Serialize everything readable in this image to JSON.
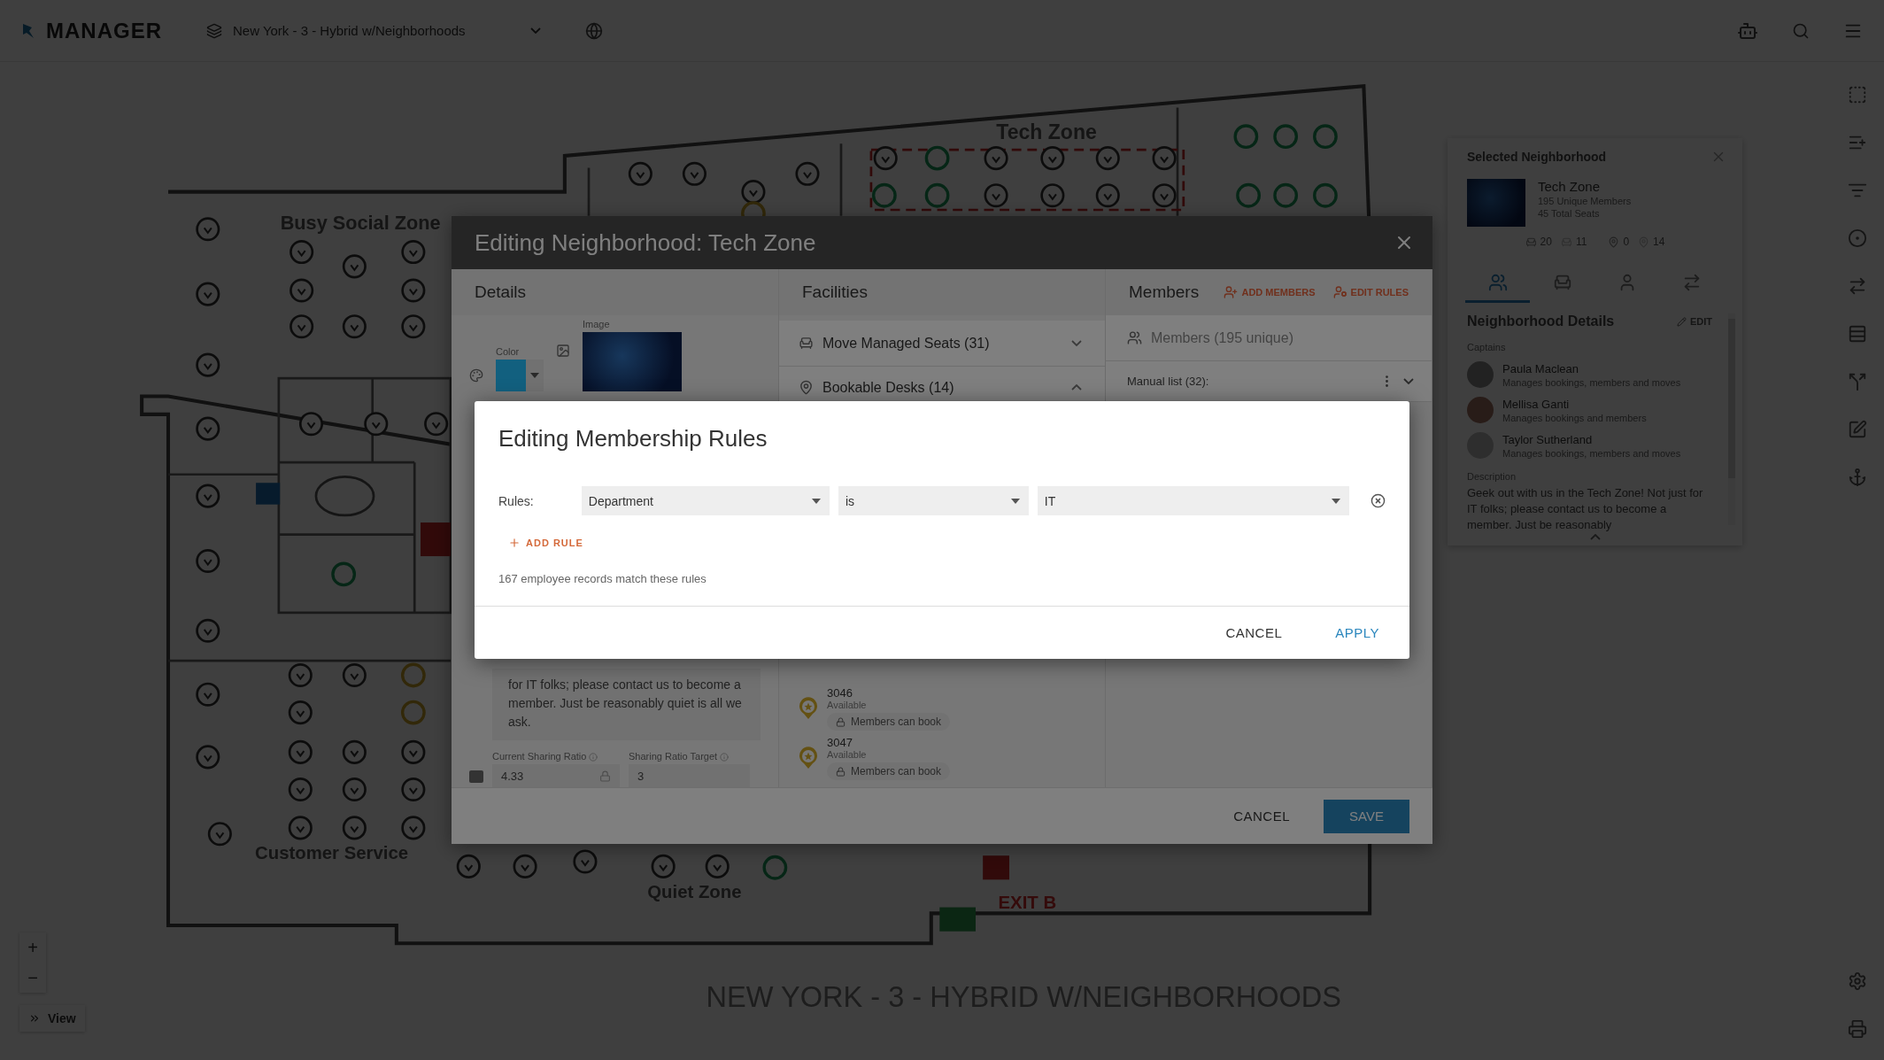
{
  "top_bar": {
    "app_name": "MANAGER",
    "floor_selector": "New York - 3 - Hybrid w/Neighborhoods"
  },
  "floor_map": {
    "zone_labels": [
      "Tech Zone",
      "Busy Social Zone",
      "Customer Service",
      "Quiet Zone"
    ],
    "exit_label": "EXIT B",
    "floor_title": "NEW YORK - 3 - HYBRID W/NEIGHBORHOODS"
  },
  "map_controls": {
    "zoom_in": "+",
    "zoom_out": "−",
    "view": "View"
  },
  "selected_neighborhood": {
    "title": "Selected Neighborhood",
    "name": "Tech Zone",
    "members": "195 Unique Members",
    "seats": "45 Total Seats",
    "stats": [
      {
        "kind": "seat",
        "value": "20"
      },
      {
        "kind": "seat-free",
        "value": "11"
      },
      {
        "kind": "pin",
        "value": "0"
      },
      {
        "kind": "pin-free",
        "value": "14"
      }
    ],
    "tabs": [
      {
        "kind": "members",
        "selected": true
      },
      {
        "kind": "seats",
        "selected": false
      },
      {
        "kind": "person",
        "selected": false
      },
      {
        "kind": "moves",
        "selected": false
      }
    ],
    "section_title": "Neighborhood Details",
    "edit": "EDIT",
    "captains_label": "Captains",
    "captains": [
      {
        "name": "Paula Maclean",
        "role": "Manages bookings, members and moves"
      },
      {
        "name": "Mellisa Ganti",
        "role": "Manages bookings and members"
      },
      {
        "name": "Taylor Sutherland",
        "role": "Manages bookings, members and moves"
      }
    ],
    "description_label": "Description",
    "description": "Geek out with us in the Tech Zone! Not just for IT folks; please contact us to become a member. Just be reasonably"
  },
  "edit_dialog": {
    "title": "Editing Neighborhood: Tech Zone",
    "details": {
      "heading": "Details",
      "color_label": "Color",
      "color": "#12607f",
      "image_label": "Image",
      "description": "for IT folks; please contact us to become a member. Just be reasonably quiet is all we ask.",
      "current_ratio_label": "Current Sharing Ratio",
      "current_ratio": "4.33",
      "target_ratio_label": "Sharing Ratio Target",
      "target_ratio": "3"
    },
    "facilities": {
      "heading": "Facilities",
      "groups": [
        {
          "label": "Move Managed Seats (31)",
          "kind": "seats",
          "expanded": false
        },
        {
          "label": "Bookable Desks (14)",
          "kind": "desks",
          "expanded": true
        }
      ],
      "desks": [
        {
          "number": "3046",
          "status": "Available",
          "access": "Members can book"
        },
        {
          "number": "3047",
          "status": "Available",
          "access": "Members can book"
        }
      ]
    },
    "members": {
      "heading": "Members",
      "add": "ADD MEMBERS",
      "edit_rules": "EDIT RULES",
      "summary": "Members (195 unique)",
      "manual_list": "Manual list (32):"
    },
    "buttons": {
      "cancel": "CANCEL",
      "save": "SAVE"
    }
  },
  "rules_dialog": {
    "title": "Editing Membership Rules",
    "rules_label": "Rules:",
    "rules": [
      {
        "field": "Department",
        "operator": "is",
        "value": "IT"
      }
    ],
    "add_rule": "ADD RULE",
    "match_count": "167 employee records match these rules",
    "cancel": "CANCEL",
    "apply": "APPLY"
  }
}
